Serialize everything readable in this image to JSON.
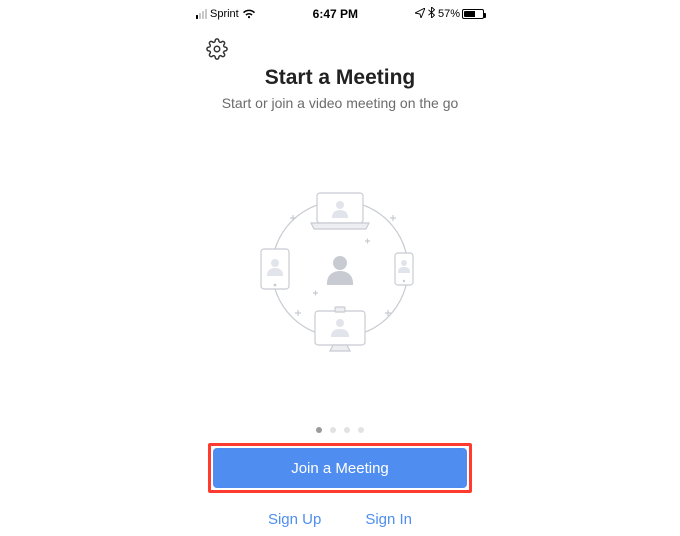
{
  "status": {
    "carrier": "Sprint",
    "time": "6:47 PM",
    "battery_pct": "57%"
  },
  "hero": {
    "title": "Start a Meeting",
    "subtitle": "Start or join a video meeting on the go"
  },
  "pager": {
    "total": 4,
    "active": 1
  },
  "cta": {
    "join": "Join a Meeting"
  },
  "links": {
    "signup": "Sign Up",
    "signin": "Sign In"
  }
}
